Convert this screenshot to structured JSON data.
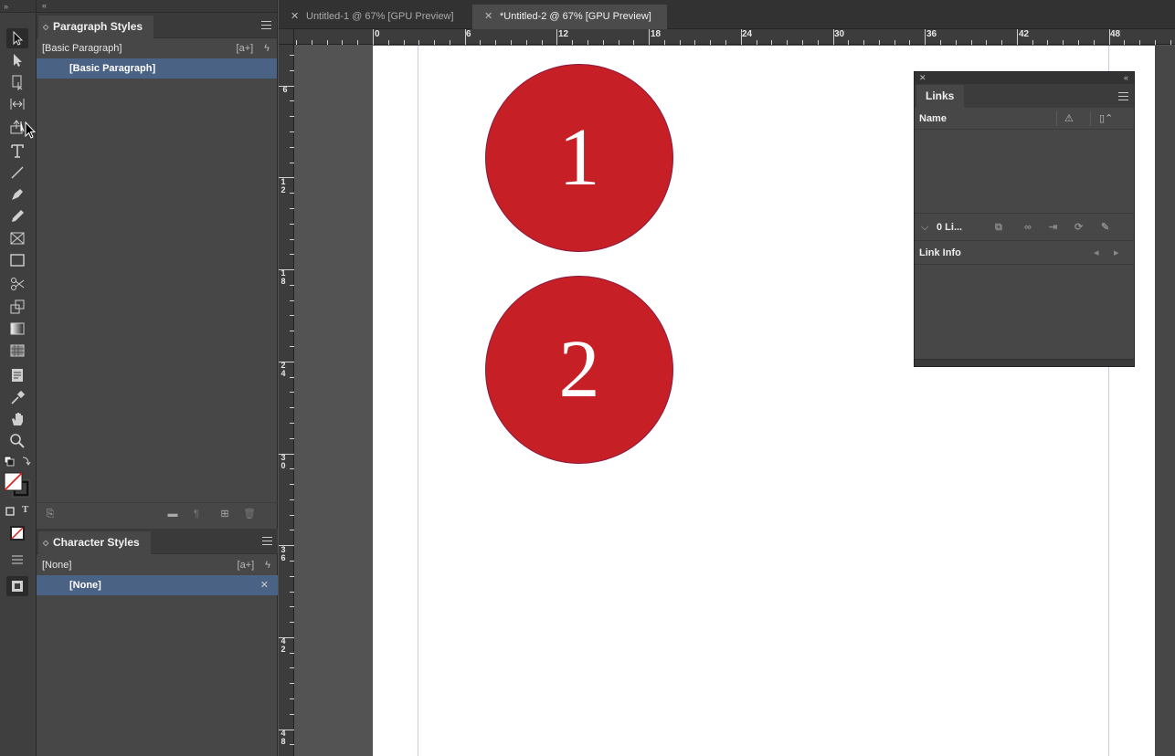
{
  "app": {
    "colors": {
      "accent_selection": "#4a6283",
      "circle_fill": "#c71f26",
      "page": "#ffffff",
      "pasteboard": "#535353"
    }
  },
  "toolbar": {
    "tools": [
      "selection-tool-icon",
      "direct-selection-tool-icon",
      "page-tool-icon",
      "gap-tool-icon",
      "content-collector-icon",
      "type-tool-icon",
      "line-tool-icon",
      "pen-tool-icon",
      "pencil-tool-icon",
      "rectangle-frame-tool-icon",
      "rectangle-tool-icon",
      "scissors-tool-icon",
      "free-transform-tool-icon",
      "gradient-swatch-tool-icon",
      "gradient-feather-tool-icon",
      "note-tool-icon",
      "eyedropper-tool-icon",
      "hand-tool-icon",
      "zoom-tool-icon"
    ],
    "container_label": "T"
  },
  "paragraph_styles": {
    "title": "Paragraph Styles",
    "group_label": "[Basic Paragraph]",
    "selected_item": "[Basic Paragraph]",
    "new_from_selection": "[a+]"
  },
  "character_styles": {
    "title": "Character Styles",
    "group_label": "[None]",
    "selected_item": "[None]",
    "new_from_selection": "[a+]"
  },
  "doc_tabs": [
    {
      "label": "Untitled-1 @ 67% [GPU Preview]",
      "active": false
    },
    {
      "label": "*Untitled-2 @ 67% [GPU Preview]",
      "active": true
    }
  ],
  "ruler": {
    "horizontal": [
      "0",
      "6",
      "12",
      "18",
      "24",
      "30",
      "36",
      "42",
      "48"
    ],
    "vertical": [
      "6",
      "12",
      "18",
      "24",
      "30",
      "36",
      "42",
      "48"
    ]
  },
  "canvas": {
    "circle1": "1",
    "circle2": "2"
  },
  "links_panel": {
    "title": "Links",
    "name_header": "Name",
    "status": "0 Li...",
    "link_info": "Link Info"
  }
}
